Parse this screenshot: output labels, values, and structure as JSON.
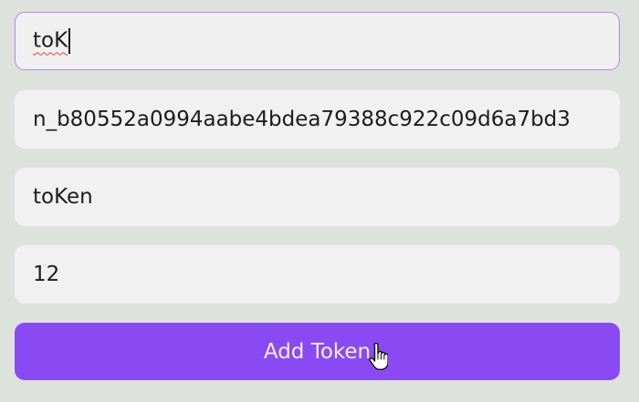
{
  "form": {
    "token_name_input": {
      "value": "toK"
    },
    "token_address_input": {
      "value": "n_b80552a0994aabe4bdea79388c922c09d6a7bd3"
    },
    "token_symbol_input": {
      "value": "toKen"
    },
    "token_decimals_input": {
      "value": "12"
    },
    "add_token_button": {
      "label": "Add Token"
    }
  },
  "icons": {
    "cursor": "hand-pointer-icon"
  },
  "colors": {
    "background": "#dde2dc",
    "field_bg": "#f1f1f1",
    "focus_border": "#a88cf0",
    "button_bg": "#8a4af3",
    "button_text": "#f4eefe"
  }
}
